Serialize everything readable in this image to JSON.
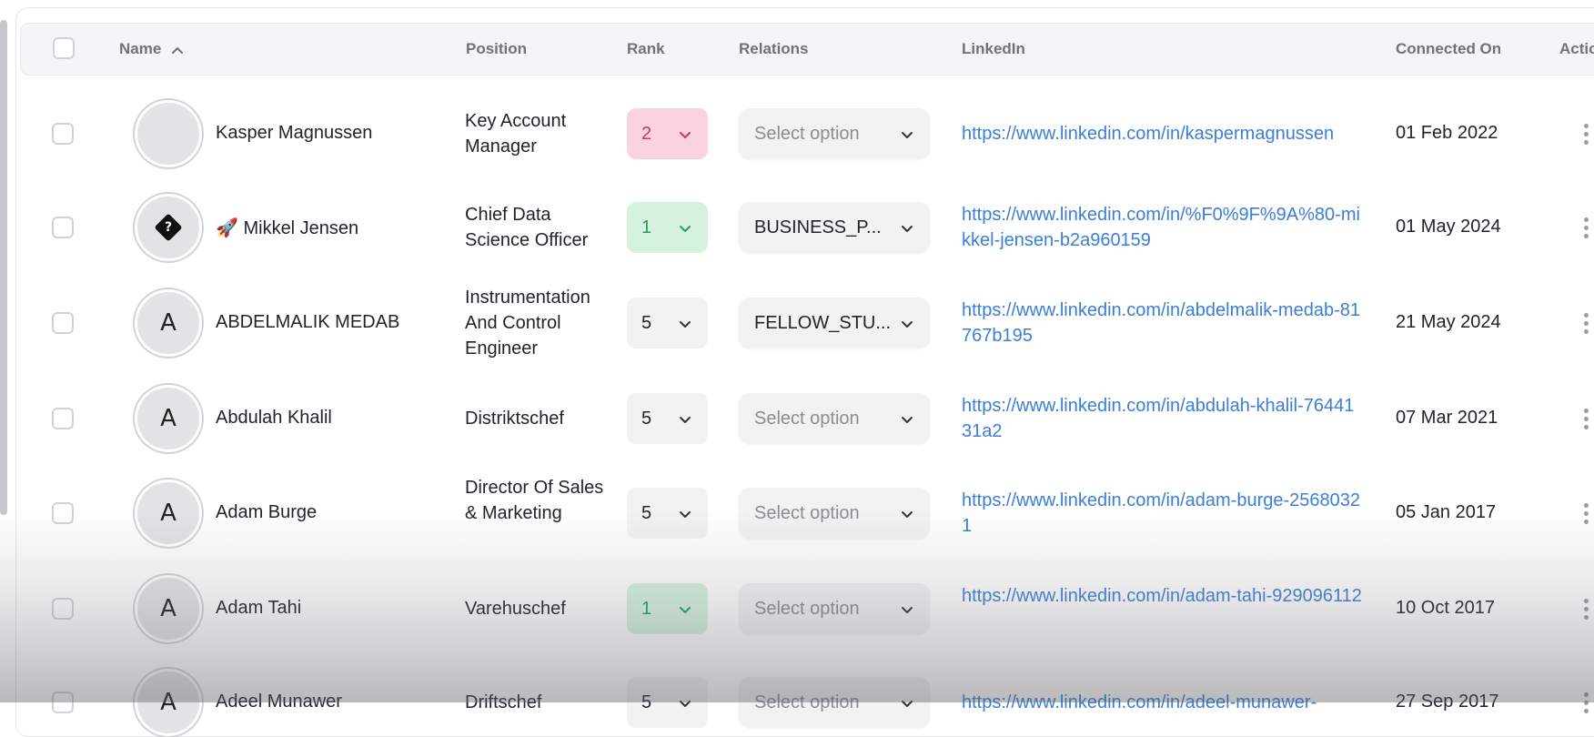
{
  "header": {
    "name": "Name",
    "position": "Position",
    "rank": "Rank",
    "relations": "Relations",
    "linkedin": "LinkedIn",
    "connected_on": "Connected On",
    "actions": "Actio"
  },
  "colors": {
    "link": "#3b7ed8",
    "rank_pink_bg": "#fbd3de",
    "rank_pink_text": "#d0365e",
    "rank_green_bg": "#d5f2df",
    "rank_green_text": "#2d9a58"
  },
  "rows": [
    {
      "avatar": "",
      "name": "Kasper Magnussen",
      "position": "Key Account Manager",
      "rank": "2",
      "relation": "Select option",
      "linkedin": "https://www.linkedin.com/in/kaspermagnussen",
      "connected": "01 Feb 2022"
    },
    {
      "avatar": "?",
      "name": "🚀 Mikkel Jensen",
      "position": "Chief Data Science Officer",
      "rank": "1",
      "relation": "BUSINESS_P...",
      "linkedin": "https://www.linkedin.com/in/%F0%9F%9A%80-mikkel-jensen-b2a960159",
      "connected": "01 May 2024"
    },
    {
      "avatar": "A",
      "name": "ABDELMALIK MEDAB",
      "position": "Instrumentation And Control Engineer",
      "rank": "5",
      "relation": "FELLOW_STU...",
      "linkedin": "https://www.linkedin.com/in/abdelmalik-medab-81767b195",
      "connected": "21 May 2024"
    },
    {
      "avatar": "A",
      "name": "Abdulah Khalil",
      "position": "Distriktschef",
      "rank": "5",
      "relation": "Select option",
      "linkedin": "https://www.linkedin.com/in/abdulah-khalil-7644131a2",
      "connected": "07 Mar 2021"
    },
    {
      "avatar": "A",
      "name": "Adam Burge",
      "position": "Director Of Sales & Marketing",
      "rank": "5",
      "relation": "Select option",
      "linkedin": "https://www.linkedin.com/in/adam-burge-25680321",
      "connected": "05 Jan 2017"
    },
    {
      "avatar": "A",
      "name": "Adam Tahi",
      "position": "Varehuschef",
      "rank": "1",
      "relation": "Select option",
      "linkedin": "https://www.linkedin.com/in/adam-tahi-929096112",
      "connected": "10 Oct 2017"
    },
    {
      "avatar": "A",
      "name": "Adeel Munawer",
      "position": "Driftschef",
      "rank": "5",
      "relation": "Select option",
      "linkedin": "https://www.linkedin.com/in/adeel-munawer-",
      "connected": "27 Sep 2017"
    }
  ]
}
